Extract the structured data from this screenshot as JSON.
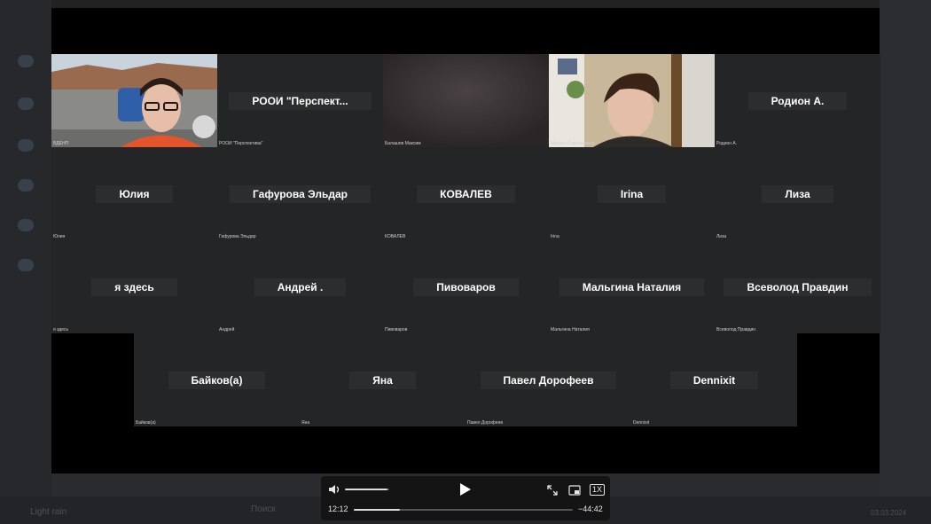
{
  "participants_row1": [
    {
      "name": "",
      "label": "ВДЕНП",
      "camera": "game"
    },
    {
      "name": "РООИ  \"Перспект...",
      "label": "РООИ \"Перспектива\""
    },
    {
      "name": "",
      "label": "Балашов Максим",
      "camera": "blur"
    },
    {
      "name": "",
      "label": "Михаил Стрельников",
      "camera": "room"
    },
    {
      "name": "Родион А.",
      "label": "Родион А."
    }
  ],
  "participants_row2": [
    {
      "name": "Юлия",
      "label": "Юлия"
    },
    {
      "name": "Гафурова Эльдар",
      "label": "Гафурова Эльдар"
    },
    {
      "name": "КОВАЛЕВ",
      "label": "КОВАЛЕВ"
    },
    {
      "name": "Irina",
      "label": "Irina"
    },
    {
      "name": "Лиза",
      "label": "Лиза"
    }
  ],
  "participants_row3": [
    {
      "name": "я здесь",
      "label": "я здесь"
    },
    {
      "name": "Андрей .",
      "label": "Андрей"
    },
    {
      "name": "Пивоваров",
      "label": "Пивоваров"
    },
    {
      "name": "Мальгина Наталия",
      "label": "Мальгина Наталия"
    },
    {
      "name": "Всеволод Правдин",
      "label": "Всеволод Правдин"
    }
  ],
  "participants_row4": [
    {
      "name": "Байков(а)",
      "label": "Байков(а)"
    },
    {
      "name": "Яна",
      "label": "Яна"
    },
    {
      "name": "Павел Дорофеев",
      "label": "Павел Дорофеев"
    },
    {
      "name": "Dennixit",
      "label": "Dennixit"
    }
  ],
  "player": {
    "current_time": "12:12",
    "remaining_time": "−44:42",
    "speed": "1X",
    "volume_level": 0.95,
    "progress": 0.21
  },
  "background": {
    "taskbar_search": "Поиск",
    "weather": "Light rain",
    "date": "03.03.2024"
  },
  "icons": {
    "volume": "volume-icon",
    "play": "play-icon",
    "fullscreen": "fullscreen-icon",
    "pip": "picture-in-picture-icon"
  }
}
